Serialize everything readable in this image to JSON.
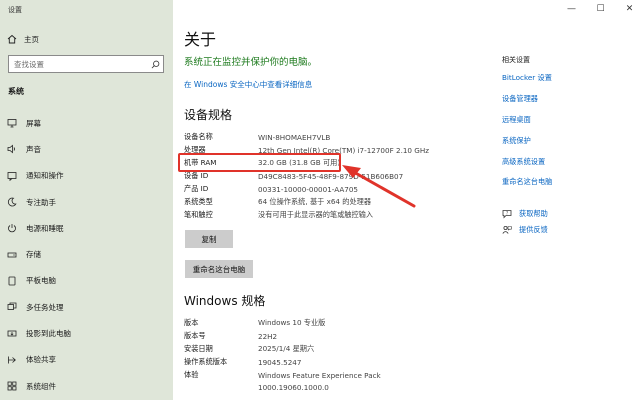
{
  "app": {
    "title": "设置"
  },
  "window_controls": {
    "minimize": "—",
    "maximize": "☐",
    "close": "✕"
  },
  "sidebar": {
    "home_label": "主页",
    "search_placeholder": "查找设置",
    "section_title": "系统",
    "items": [
      {
        "label": "屏幕",
        "icon": "monitor-icon"
      },
      {
        "label": "声音",
        "icon": "speaker-icon"
      },
      {
        "label": "通知和操作",
        "icon": "notification-icon"
      },
      {
        "label": "专注助手",
        "icon": "moon-icon"
      },
      {
        "label": "电源和睡眠",
        "icon": "power-icon"
      },
      {
        "label": "存储",
        "icon": "storage-icon"
      },
      {
        "label": "平板电脑",
        "icon": "tablet-icon"
      },
      {
        "label": "多任务处理",
        "icon": "multitask-icon"
      },
      {
        "label": "投影到此电脑",
        "icon": "project-icon"
      },
      {
        "label": "体验共享",
        "icon": "share-icon"
      },
      {
        "label": "系统组件",
        "icon": "components-icon"
      }
    ]
  },
  "main": {
    "title": "关于",
    "protect_text": "系统正在监控并保护你的电脑。",
    "security_link": "在 Windows 安全中心中查看详细信息",
    "device_heading": "设备规格",
    "device_specs": [
      {
        "key": "设备名称",
        "value": "WIN-8HOMAEH7VLB"
      },
      {
        "key": "处理器",
        "value": "12th Gen Intel(R) Core(TM) i7-12700F   2.10 GHz"
      },
      {
        "key": "机带 RAM",
        "value": "32.0 GB (31.8 GB 可用)"
      },
      {
        "key": "设备 ID",
        "value": "D49C8483-5F45-48F9-879D-51B606B07"
      },
      {
        "key": "产品 ID",
        "value": "00331-10000-00001-AA705"
      },
      {
        "key": "系统类型",
        "value": "64 位操作系统, 基于 x64 的处理器"
      },
      {
        "key": "笔和触控",
        "value": "没有可用于此显示器的笔或触控输入"
      }
    ],
    "copy_button": "复制",
    "rename_button": "重命名这台电脑",
    "windows_heading": "Windows 规格",
    "windows_specs": [
      {
        "key": "版本",
        "value": "Windows 10 专业版"
      },
      {
        "key": "版本号",
        "value": "22H2"
      },
      {
        "key": "安装日期",
        "value": "2025/1/4 星期六"
      },
      {
        "key": "操作系统版本",
        "value": "19045.5247"
      },
      {
        "key": "体验",
        "value": "Windows Feature Experience Pack"
      },
      {
        "key": "",
        "value": "1000.19060.1000.0"
      }
    ]
  },
  "right": {
    "related_title": "相关设置",
    "related_links": [
      "BitLocker 设置",
      "设备管理器",
      "远程桌面",
      "系统保护",
      "高级系统设置",
      "重命名这台电脑"
    ],
    "help": [
      {
        "label": "获取帮助",
        "icon": "help-chat-icon"
      },
      {
        "label": "提供反馈",
        "icon": "feedback-icon"
      }
    ]
  },
  "colors": {
    "sidebar_bg": "#dfe6d9",
    "link": "#0a66c2",
    "protect": "#1d7a1d",
    "annotation": "#e0332a"
  }
}
